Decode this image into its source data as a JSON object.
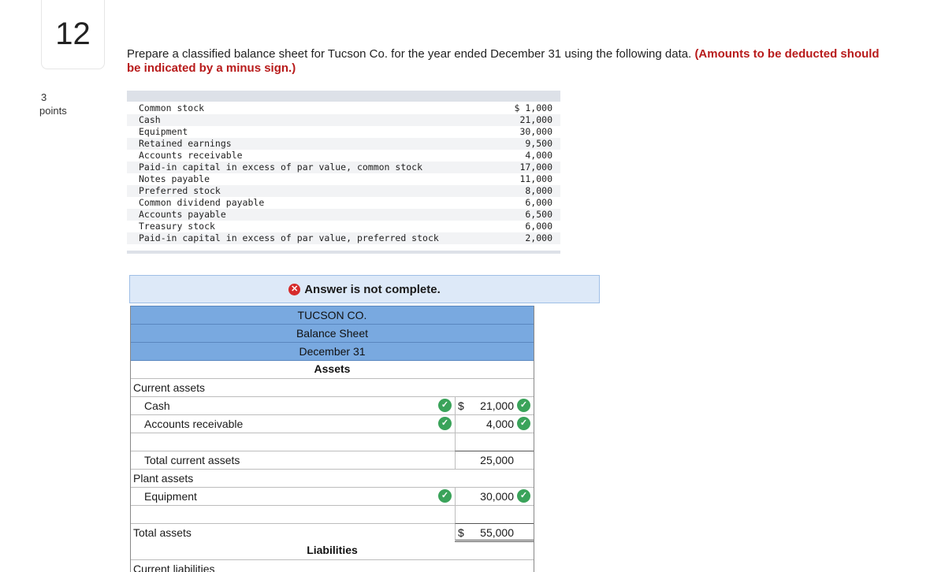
{
  "question": {
    "number": "12",
    "points_value": "3",
    "points_label": "points",
    "prompt_text": "Prepare a classified balance sheet for Tucson Co. for the year ended December 31 using the following data. ",
    "prompt_emphasis": "(Amounts to be deducted should be indicated by a minus sign.)"
  },
  "data_table": [
    {
      "label": "Common stock",
      "amount": "$ 1,000"
    },
    {
      "label": "Cash",
      "amount": "21,000"
    },
    {
      "label": "Equipment",
      "amount": "30,000"
    },
    {
      "label": "Retained earnings",
      "amount": "9,500"
    },
    {
      "label": "Accounts receivable",
      "amount": "4,000"
    },
    {
      "label": "Paid-in capital in excess of par value, common stock",
      "amount": "17,000"
    },
    {
      "label": "Notes payable",
      "amount": "11,000"
    },
    {
      "label": "Preferred stock",
      "amount": "8,000"
    },
    {
      "label": "Common dividend payable",
      "amount": "6,000"
    },
    {
      "label": "Accounts payable",
      "amount": "6,500"
    },
    {
      "label": "Treasury stock",
      "amount": "6,000"
    },
    {
      "label": "Paid-in capital in excess of par value, preferred stock",
      "amount": "2,000"
    }
  ],
  "status": {
    "message": "Answer is not complete.",
    "icon": "x-circle-icon",
    "icon_color": "#d62b2b"
  },
  "sheet": {
    "company": "TUCSON CO.",
    "title": "Balance Sheet",
    "date": "December 31",
    "assets_header": "Assets",
    "current_assets_label": "Current assets",
    "cash_label": "Cash",
    "cash_dollar": "$",
    "cash_value": "21,000",
    "ar_label": "Accounts receivable",
    "ar_value": "4,000",
    "total_current_assets_label": "Total current assets",
    "total_current_assets_value": "25,000",
    "plant_assets_label": "Plant assets",
    "equipment_label": "Equipment",
    "equipment_value": "30,000",
    "total_assets_label": "Total assets",
    "total_assets_dollar": "$",
    "total_assets_value": "55,000",
    "liabilities_header": "Liabilities",
    "current_liabilities_label": "Current liabilities",
    "header_color": "#79a9e0",
    "check_color": "#3aa35a"
  }
}
